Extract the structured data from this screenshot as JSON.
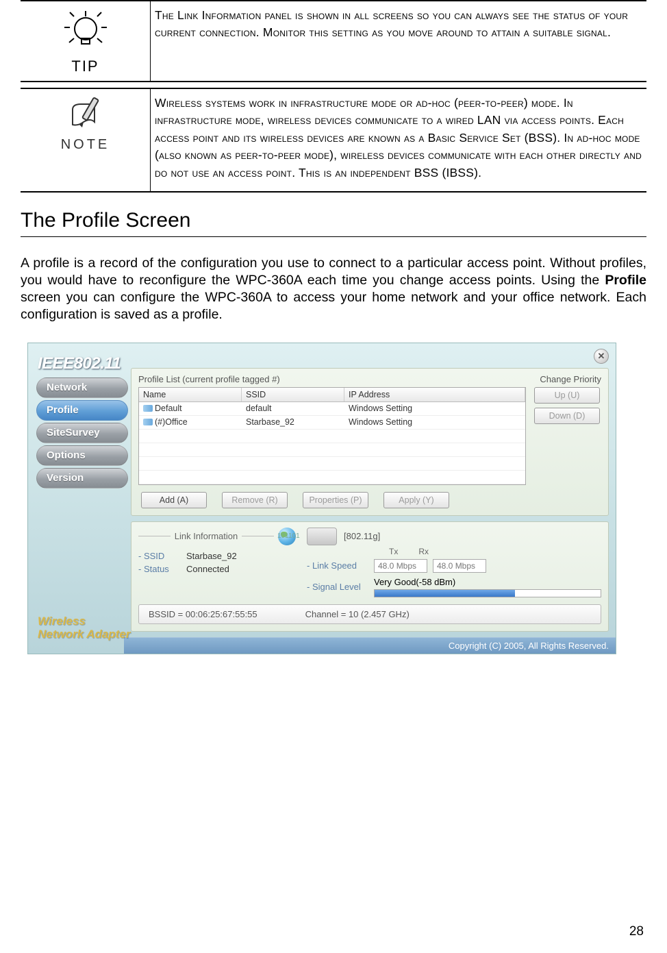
{
  "tip": {
    "label": "TIP",
    "text": "The Link Information panel is shown in all screens so you can always see the status of your current connection. Monitor this setting as you move around to attain a suitable signal."
  },
  "note": {
    "label": "NOTE",
    "text": "Wireless systems work in infrastructure mode or ad-hoc (peer-to-peer) mode. In infrastructure mode, wireless devices communicate to a wired LAN via access points. Each access point and its wireless devices are known as a Basic Service Set (BSS). In ad-hoc mode (also known as peer-to-peer mode), wireless devices communicate with each other directly and do not use an access point. This is an independent BSS (IBSS)."
  },
  "section_title": "The Profile Screen",
  "intro": {
    "pre": "A profile is a record of the configuration you use to connect to a particular access point. Without profiles, you would have to reconfigure the WPC-360A each time you change access points. Using the ",
    "bold": "Profile",
    "post": " screen you can configure the WPC-360A to access your home network and your office network. Each configuration is saved as a profile."
  },
  "app": {
    "logo": "IEEE802.11",
    "nav": {
      "network": "Network",
      "profile": "Profile",
      "sitesurvey": "SiteSurvey",
      "options": "Options",
      "version": "Version"
    },
    "wna_line1": "Wireless",
    "wna_line2": "Network Adapter",
    "profile_list_label": "Profile List (current profile tagged #)",
    "change_priority_label": "Change Priority",
    "up_btn": "Up (U)",
    "down_btn": "Down (D)",
    "table": {
      "headers": {
        "name": "Name",
        "ssid": "SSID",
        "ip": "IP Address"
      },
      "rows": [
        {
          "name": "Default",
          "ssid": "default",
          "ip": "Windows Setting"
        },
        {
          "name": "(#)Office",
          "ssid": "Starbase_92",
          "ip": "Windows Setting"
        }
      ]
    },
    "buttons": {
      "add": "Add (A)",
      "remove": "Remove (R)",
      "properties": "Properties (P)",
      "apply": "Apply (Y)"
    },
    "link": {
      "title": "Link Information",
      "ssid_label": "SSID",
      "ssid_value": "Starbase_92",
      "status_label": "Status",
      "status_value": "Connected",
      "mode": "[802.11g]",
      "tx_label": "Tx",
      "rx_label": "Rx",
      "linkspeed_label": "Link Speed",
      "tx_rate": "48.0 Mbps",
      "rx_rate": "48.0 Mbps",
      "signal_label": "Signal Level",
      "signal_value": "Very Good(-58 dBm)",
      "signal_percent": 62,
      "bssid": "BSSID = 00:06:25:67:55:55",
      "channel": "Channel = 10 (2.457 GHz)"
    },
    "copyright": "Copyright (C) 2005, All Rights Reserved."
  },
  "page_number": "28"
}
